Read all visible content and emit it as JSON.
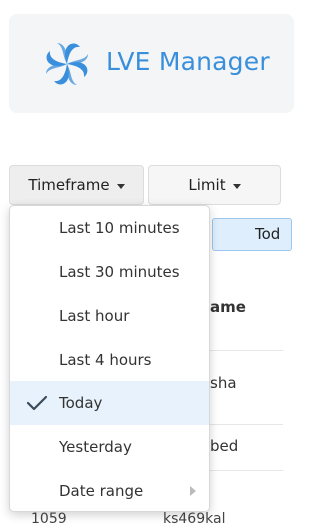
{
  "logo": {
    "text": "LVE Manager",
    "icon": "pinwheel-logo-icon",
    "color": "#3a8fdc"
  },
  "toolbar": {
    "timeframe_label": "Timeframe",
    "limit_label": "Limit",
    "active_chip": "Tod"
  },
  "table": {
    "header_fragment": "ame",
    "rows": [
      {
        "id": "",
        "name": "sha"
      },
      {
        "id": "",
        "name": "bed"
      },
      {
        "id": "1059",
        "name": "ks469kal"
      }
    ]
  },
  "timeframe_menu": {
    "items": [
      {
        "label": "Last 10 minutes",
        "selected": false
      },
      {
        "label": "Last 30 minutes",
        "selected": false
      },
      {
        "label": "Last hour",
        "selected": false
      },
      {
        "label": "Last 4 hours",
        "selected": false
      },
      {
        "label": "Today",
        "selected": true
      },
      {
        "label": "Yesterday",
        "selected": false
      },
      {
        "label": "Date range",
        "selected": false,
        "has_submenu": true
      }
    ]
  },
  "colors": {
    "accent": "#3a8fdc",
    "selected_bg": "#e7f2fc",
    "chip_bg": "#deeefc"
  }
}
